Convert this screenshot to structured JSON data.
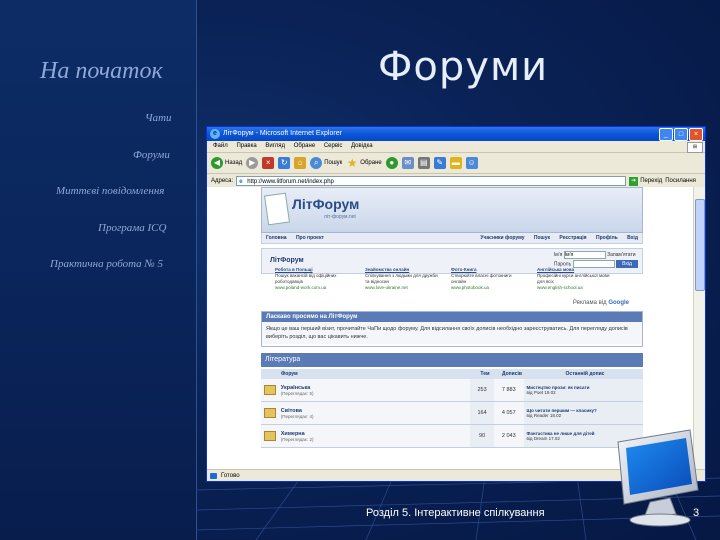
{
  "sidebar": {
    "title": "На початок",
    "items": [
      {
        "label": "Чати"
      },
      {
        "label": "Форуми"
      },
      {
        "label": "Миттєві повідомлення"
      },
      {
        "label": "Програма ICQ"
      },
      {
        "label": "Практична робота № 5"
      }
    ]
  },
  "slide": {
    "title": "Форуми",
    "footer": "Розділ 5. Інтерактивне спілкування",
    "page_number": "3"
  },
  "browser": {
    "window_title": "ЛітФорум - Microsoft Internet Explorer",
    "menu": [
      "Файл",
      "Правка",
      "Вигляд",
      "Обране",
      "Сервіс",
      "Довідка"
    ],
    "toolbar": {
      "back": "Назад",
      "search": "Пошук",
      "favorites": "Обране"
    },
    "address_label": "Адреса:",
    "address_value": "http://www.litforum.net/index.php",
    "go_label": "Перехід",
    "links_label": "Посилання",
    "status_text": "Готово"
  },
  "forum": {
    "logo": "ЛітФорум",
    "logo_sub": "літ-форум.net",
    "nav_left": [
      "Головна",
      "Про проект"
    ],
    "nav_right": [
      "Учасники форуму",
      "Пошук",
      "Реєстрація",
      "Профіль",
      "Вхід"
    ],
    "forum_name": "ЛітФорум",
    "login": {
      "user_label": "Ім'я",
      "user_value": "Ім'я",
      "pass_label": "Пароль",
      "remember": "Запам'ятати",
      "button": "Вхід"
    },
    "ads": [
      {
        "title": "Робота в Польщі",
        "desc": "Пошук вакансій від офіційних роботодавців",
        "url": "www.poland-work.com.ua"
      },
      {
        "title": "Знайомства онлайн",
        "desc": "Спілкування з людьми для дружби та відносин",
        "url": "www.love-ukraine.net"
      },
      {
        "title": "Фото-Книга",
        "desc": "Створюйте власні фотокниги онлайн",
        "url": "www.photobook.ua"
      },
      {
        "title": "Англійська мова",
        "desc": "Професійні курси англійської мови для всіх",
        "url": "www.english-school.ua"
      }
    ],
    "google_label": "Реклама від",
    "google_brand": "Google",
    "welcome_title": "Ласкаво просимо на ЛітФорум",
    "welcome_text": "Якщо це ваш перший візит, прочитайте ЧаПи щодо форуму. Для відсилання своїх дописів необхідно зареєструватись. Для перегляду дописів виберіть розділ, що вас цікавить нижче.",
    "category": "Література",
    "columns": [
      "Форум",
      "Тем",
      "Дописів",
      "Останній допис"
    ],
    "rows": [
      {
        "name": "Українська",
        "desc": "(Переглядає: 5)",
        "topics": "253",
        "posts": "7 883",
        "last": "Мистецтво прози: як писати",
        "last_meta": "від Poet 19.02"
      },
      {
        "name": "Світова",
        "desc": "(Переглядає: 4)",
        "topics": "164",
        "posts": "4 057",
        "last": "Що читати першим — класику?",
        "last_meta": "від Reader 18.02"
      },
      {
        "name": "Химерна",
        "desc": "(Переглядає: 2)",
        "topics": "90",
        "posts": "2 043",
        "last": "Фантастика не лише для дітей",
        "last_meta": "від Dream 17.02"
      }
    ]
  },
  "colors": {
    "background": "#0a2256",
    "sidebar_text": "#8fa8d8",
    "title_text": "#e6eefc",
    "xp_blue": "#0a56d8"
  }
}
